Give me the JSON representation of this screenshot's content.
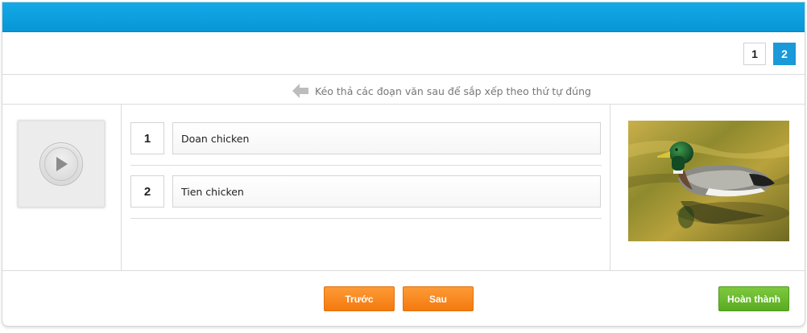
{
  "header": {
    "accent": "#0796d6"
  },
  "pager": {
    "pages": [
      "1",
      "2"
    ],
    "active_index": 1
  },
  "instruction": {
    "icon": "arrow-left-icon",
    "text": "Kéo thả các đoạn văn sau để sắp xếp theo thứ tự đúng"
  },
  "media": {
    "icon": "play-icon"
  },
  "items": [
    {
      "number": "1",
      "text": "Doan chicken"
    },
    {
      "number": "2",
      "text": "Tien chicken"
    }
  ],
  "image": {
    "subject": "duck-photo"
  },
  "footer": {
    "prev_label": "Trước",
    "next_label": "Sau",
    "done_label": "Hoàn thành",
    "orange": "#f47a0f",
    "green": "#5aab22"
  }
}
